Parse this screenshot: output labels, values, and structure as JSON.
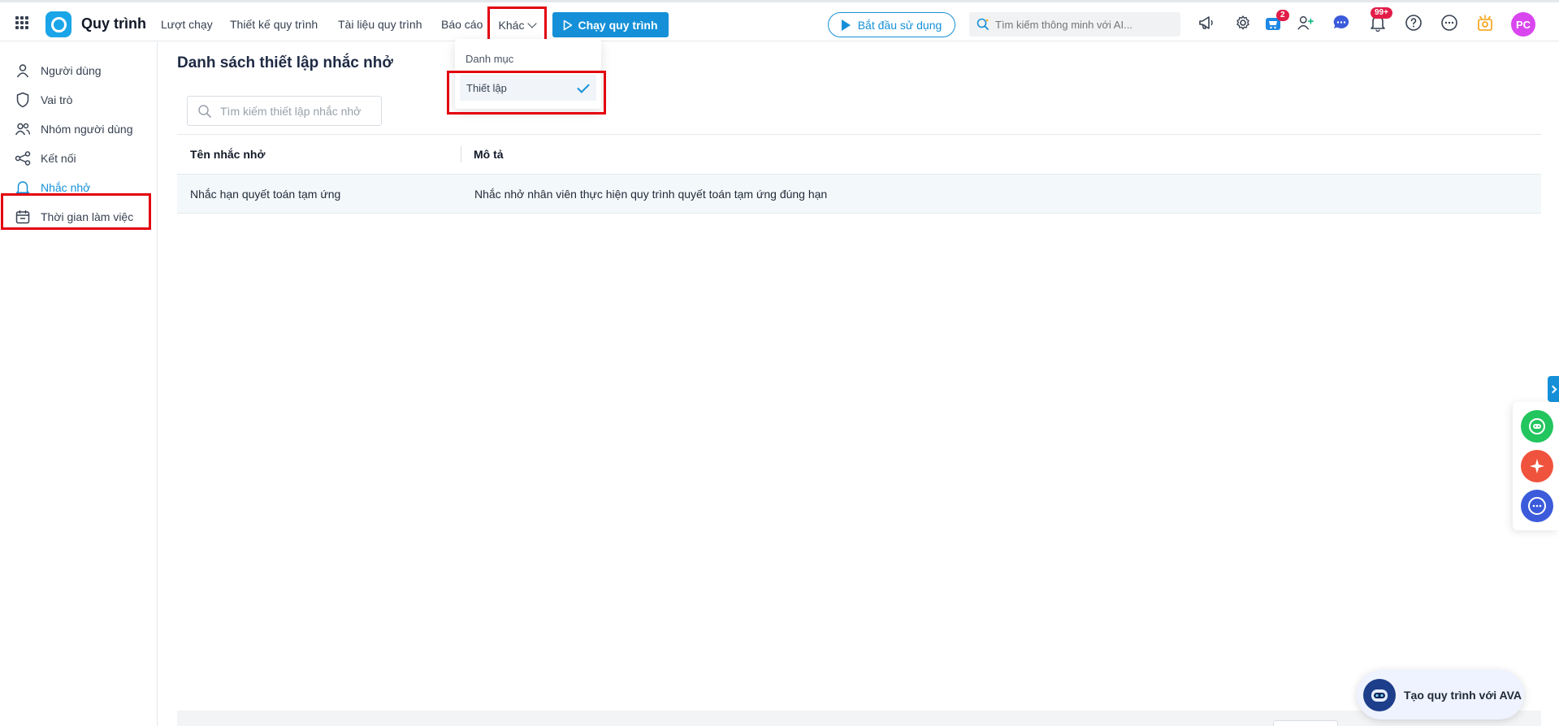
{
  "topbar": {
    "app_title": "Quy trình",
    "nav": [
      "Lượt chạy",
      "Thiết kế quy trình",
      "Tài liệu quy trình",
      "Báo cáo"
    ],
    "more_label": "Khác",
    "run_button": "Chạy quy trình",
    "start_button": "Bắt đầu sử dụng",
    "search_placeholder": "Tìm kiếm thông minh với AI...",
    "cart_badge": "2",
    "notif_badge": "99+",
    "avatar_initials": "PC"
  },
  "dropdown": {
    "category": "Danh mục",
    "item": "Thiết lập"
  },
  "sidebar": {
    "items": [
      {
        "label": "Người dùng",
        "icon": "user-icon"
      },
      {
        "label": "Vai trò",
        "icon": "shield-icon"
      },
      {
        "label": "Nhóm người dùng",
        "icon": "users-icon"
      },
      {
        "label": "Kết nối",
        "icon": "share-icon"
      },
      {
        "label": "Nhắc nhở",
        "icon": "bell-icon"
      },
      {
        "label": "Thời gian làm việc",
        "icon": "calendar-icon"
      }
    ],
    "active_index": 4
  },
  "main": {
    "title": "Danh sách thiết lập nhắc nhở",
    "search_placeholder": "Tìm kiếm thiết lập nhắc nhở",
    "columns": [
      "Tên nhắc nhở",
      "Mô tả"
    ],
    "rows": [
      [
        "Nhắc hạn quyết toán tạm ứng",
        "Nhắc nhở nhân viên thực hiện quy trình quyết toán tạm ứng đúng hạn"
      ]
    ]
  },
  "ava": {
    "label": "Tạo quy trình với AVA"
  },
  "colors": {
    "accent": "#1590d8",
    "highlight": "#e3000f",
    "badge": "#e11d48",
    "avatar": "#d946ef"
  }
}
